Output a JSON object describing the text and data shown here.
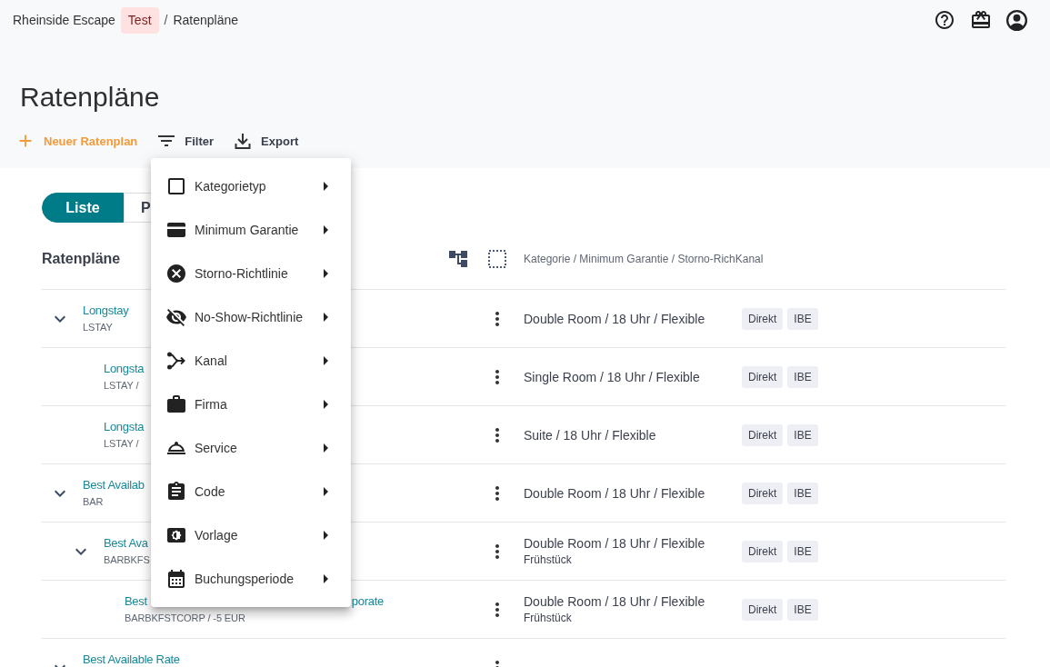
{
  "breadcrumb": [
    {
      "kind": "link",
      "label": "Rheinside Escape"
    },
    {
      "kind": "badge",
      "label": "Test"
    },
    {
      "kind": "separator",
      "label": "/"
    },
    {
      "kind": "current",
      "label": "Ratenpläne"
    }
  ],
  "page_title": "Ratenpläne",
  "toolbar": [
    {
      "kind": "add",
      "label": "Neuer Ratenplan"
    },
    {
      "kind": "filter",
      "label": "Filter"
    },
    {
      "kind": "export",
      "label": "Export"
    }
  ],
  "view_toggle": [
    {
      "label": "Liste",
      "selected": true
    },
    {
      "label": "P",
      "selected": false
    }
  ],
  "section": {
    "title": "Ratenpläne",
    "columns": "Kategorie / Minimum Garantie / Storno-RichKanal"
  },
  "rate_plans": [
    {
      "title": "Longstay",
      "code": "LSTAY",
      "expanded": true,
      "details": "Double Room / 18 Uhr / Flexible",
      "channels": [
        "Direkt",
        "IBE"
      ],
      "children": [
        {
          "title": "Longsta",
          "code": "LSTAY /",
          "details": "Single Room / 18 Uhr / Flexible",
          "channels": [
            "Direkt",
            "IBE"
          ]
        },
        {
          "title": "Longsta",
          "code": "LSTAY /",
          "details": "Suite / 18 Uhr / Flexible",
          "channels": [
            "Direkt",
            "IBE"
          ]
        }
      ]
    },
    {
      "title": "Best Availab",
      "code": "BAR",
      "expanded": true,
      "details": "Double Room / 18 Uhr / Flexible",
      "channels": [
        "Direkt",
        "IBE"
      ],
      "children": [
        {
          "title": "Best Ava",
          "code": "BARBKFS",
          "expanded": true,
          "details": "Double Room / 18 Uhr / Flexible",
          "extra": "Frühstück",
          "channels": [
            "Direkt",
            "IBE"
          ],
          "children": [
            {
              "title": "Best",
              "title_end": "porate",
              "code": "BARBKFSTCORP / -5 EUR",
              "details": "Double Room / 18 Uhr / Flexible",
              "extra": "Frühstück",
              "channels": [
                "Direkt",
                "IBE"
              ]
            }
          ]
        }
      ]
    },
    {
      "title": "Best Available Rate",
      "expanded": true
    }
  ],
  "filter_menu": {
    "items": [
      {
        "label": "Kategorietyp",
        "submenu": true
      },
      {
        "label": "Minimum Garantie",
        "submenu": true
      },
      {
        "label": "Storno-Richtlinie",
        "submenu": true
      },
      {
        "label": "No-Show-Richtlinie",
        "submenu": true
      },
      {
        "label": "Kanal",
        "submenu": true
      },
      {
        "label": "Firma",
        "submenu": true
      },
      {
        "label": "Service",
        "submenu": true
      },
      {
        "label": "Code",
        "submenu": true
      },
      {
        "label": "Vorlage",
        "submenu": true
      },
      {
        "label": "Buchungsperiode",
        "submenu": true
      }
    ]
  }
}
